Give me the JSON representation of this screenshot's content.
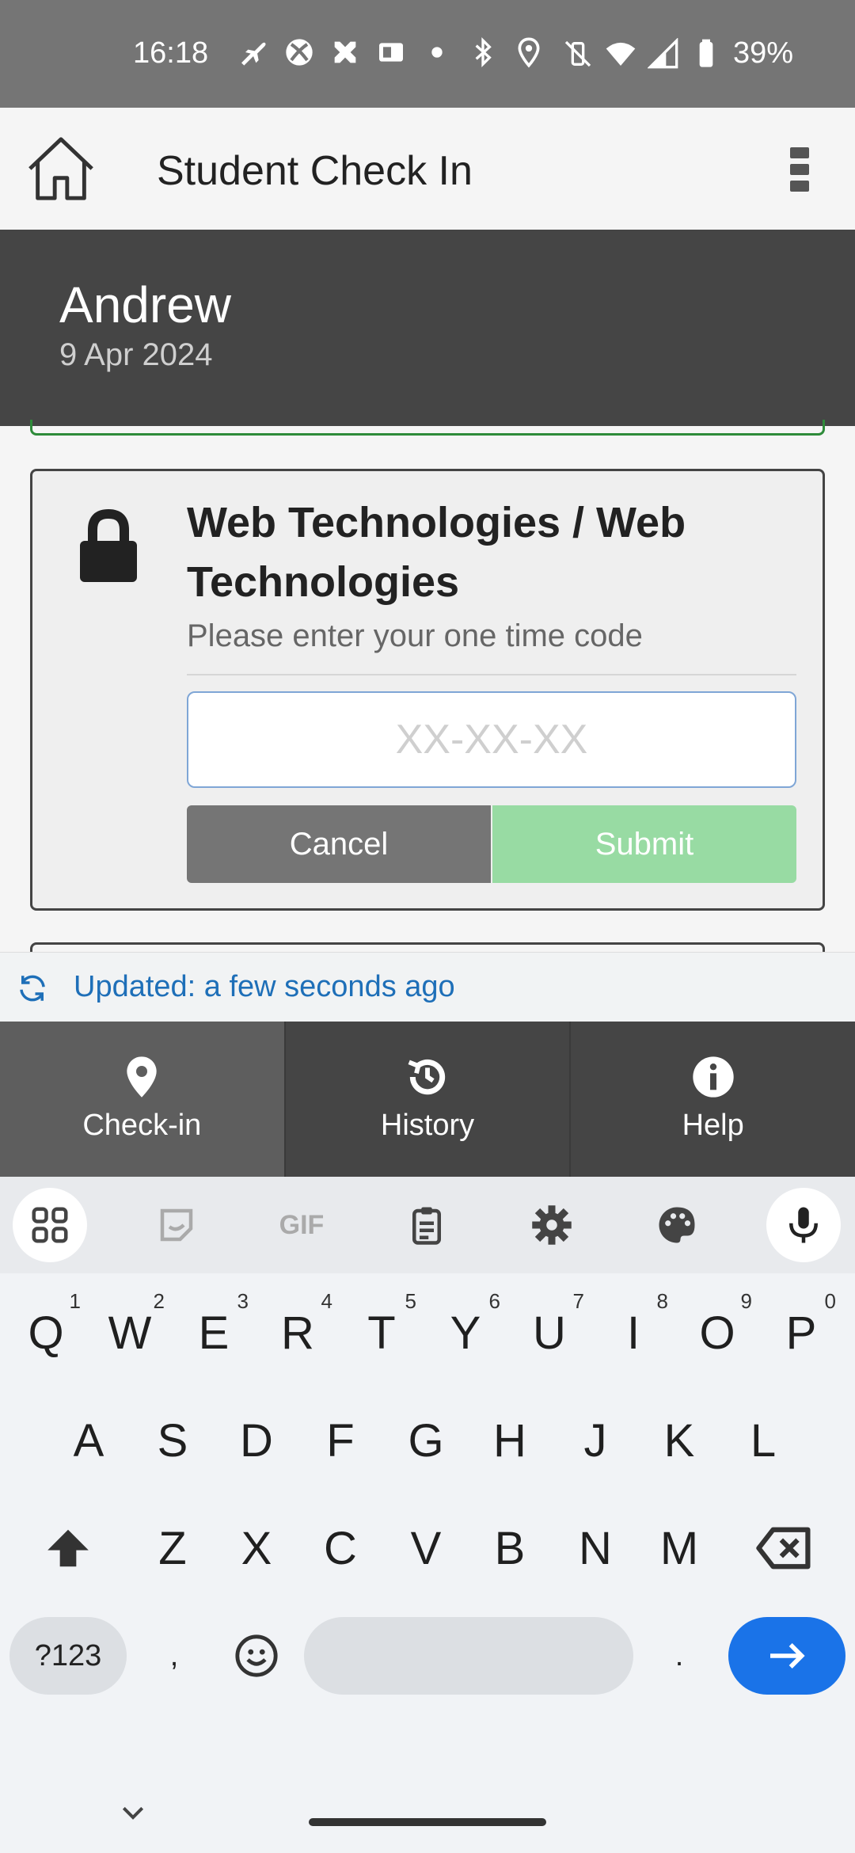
{
  "status_bar": {
    "time": "16:18",
    "battery": "39%",
    "left_icons": [
      "flight-mode-icon",
      "xbox-icon",
      "gallery-icon",
      "outlook-icon",
      "dot-icon",
      "bluetooth-icon",
      "location-icon"
    ],
    "right_icons": [
      "vibrate-off-icon",
      "wifi-icon",
      "signal-icon",
      "battery-icon"
    ]
  },
  "app_bar": {
    "title": "Student Check In"
  },
  "header": {
    "name": "Andrew",
    "date": "9 Apr 2024"
  },
  "card": {
    "title": "Web Technologies / Web Technologies",
    "prompt": "Please enter your one time code",
    "input_placeholder": "XX-XX-XX",
    "input_value": "",
    "cancel_label": "Cancel",
    "submit_label": "Submit"
  },
  "update": {
    "text": "Updated: a few seconds ago"
  },
  "bottom_nav": [
    {
      "label": "Check-in",
      "icon": "map-pin-icon",
      "active": true
    },
    {
      "label": "History",
      "icon": "history-icon",
      "active": false
    },
    {
      "label": "Help",
      "icon": "info-icon",
      "active": false
    }
  ],
  "keyboard": {
    "toolbar_icons": [
      "apps-grid-icon",
      "sticker-icon",
      "gif-icon",
      "clipboard-icon",
      "settings-icon",
      "palette-icon",
      "microphone-icon"
    ],
    "gif_label": "GIF",
    "row1": [
      {
        "k": "Q",
        "n": "1"
      },
      {
        "k": "W",
        "n": "2"
      },
      {
        "k": "E",
        "n": "3"
      },
      {
        "k": "R",
        "n": "4"
      },
      {
        "k": "T",
        "n": "5"
      },
      {
        "k": "Y",
        "n": "6"
      },
      {
        "k": "U",
        "n": "7"
      },
      {
        "k": "I",
        "n": "8"
      },
      {
        "k": "O",
        "n": "9"
      },
      {
        "k": "P",
        "n": "0"
      }
    ],
    "row2": [
      "A",
      "S",
      "D",
      "F",
      "G",
      "H",
      "J",
      "K",
      "L"
    ],
    "row3": [
      "Z",
      "X",
      "C",
      "V",
      "B",
      "N",
      "M"
    ],
    "symbols_label": "?123",
    "comma": ",",
    "period": "."
  },
  "colors": {
    "status_bar": "#757575",
    "header": "#454545",
    "submit_disabled": "#98dba3",
    "cancel": "#757575",
    "link": "#1e6fb8",
    "enter_key": "#1a73e8"
  }
}
